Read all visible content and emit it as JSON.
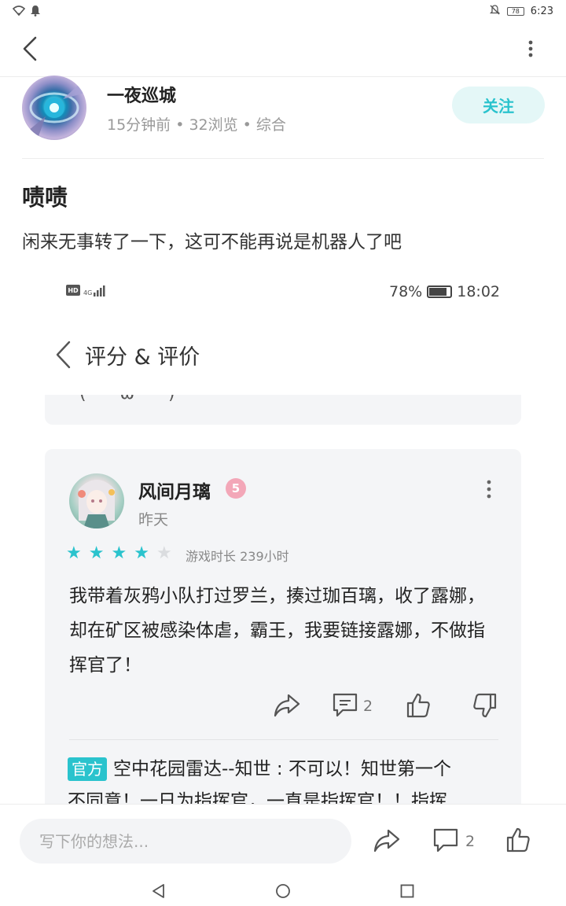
{
  "status_bar": {
    "battery": "78",
    "time": "6:23",
    "icons": [
      "wifi-icon",
      "notification-bell-icon",
      "mute-icon",
      "battery-icon"
    ]
  },
  "app_bar": {
    "icons": [
      "back-arrow-icon",
      "more-vertical-icon"
    ]
  },
  "author": {
    "name": "一夜巡城",
    "meta": "15分钟前 • 32浏览 • 综合",
    "follow_label": "关注"
  },
  "post": {
    "title": "啧啧",
    "body": "闲来无事转了一下，这可不能再说是机器人了吧"
  },
  "embedded": {
    "status": {
      "network": "4G",
      "battery": "78%",
      "time": "18:02"
    },
    "page_title": "评分 & 评价",
    "prev_card_fragment": "(  ω  )",
    "review": {
      "user_name": "风间月璃",
      "level": "5",
      "time": "昨天",
      "stars_filled": 4,
      "stars_total": 5,
      "playtime": "游戏时长 239小时",
      "text": "我带着灰鸦小队打过罗兰，揍过珈百璃，收了露娜，却在矿区被感染体虐，霸王，我要链接露娜，不做指挥官了！",
      "reply_count": "2",
      "accent": "#2ac3cd"
    },
    "official_reply": {
      "tag": "官方",
      "line1": "空中花园雷达--知世 : 不可以！知世第一个",
      "line2": "不同意！一日为指挥官，一直是指挥官！！指挥"
    }
  },
  "bottom_bar": {
    "placeholder": "写下你的想法...",
    "comment_count": "2"
  },
  "nav_bar": {
    "icons": [
      "nav-back-icon",
      "nav-home-icon",
      "nav-recents-icon"
    ]
  },
  "colors": {
    "accent": "#2ac3cd",
    "follow_bg": "#e4f7f7",
    "card_bg": "#f4f5f7"
  }
}
